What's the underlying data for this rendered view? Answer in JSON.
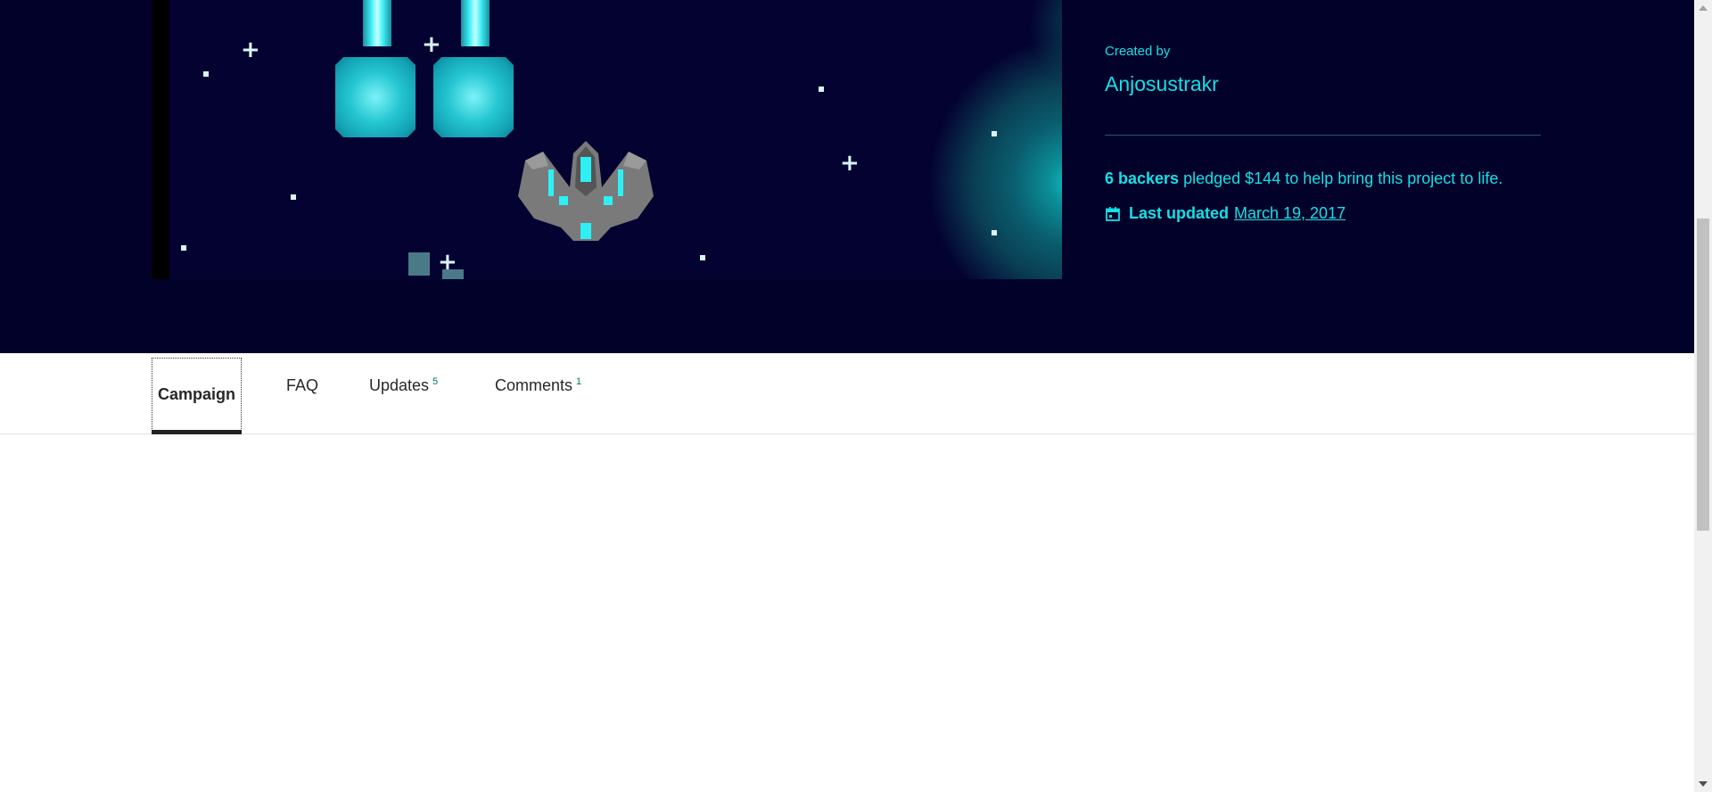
{
  "project": {
    "created_by_label": "Created by",
    "creator_name": "Anjosustrakr",
    "backers_count": "6 backers",
    "pledged_text": "pledged $144 to help bring this project to life.",
    "last_updated_label": "Last updated",
    "last_updated_date": "March 19, 2017"
  },
  "tabs": [
    {
      "label": "Campaign",
      "count": "",
      "active": true
    },
    {
      "label": "FAQ",
      "count": ""
    },
    {
      "label": "Updates",
      "count": "5"
    },
    {
      "label": "Comments",
      "count": "1"
    }
  ],
  "icons": {
    "calendar": "calendar-icon",
    "scroll_up": "scroll-up-arrow-icon",
    "scroll_down": "scroll-down-arrow-icon"
  },
  "colors": {
    "hero_background": "#02012a",
    "accent": "#15e0e6",
    "tab_count": "#037362"
  }
}
